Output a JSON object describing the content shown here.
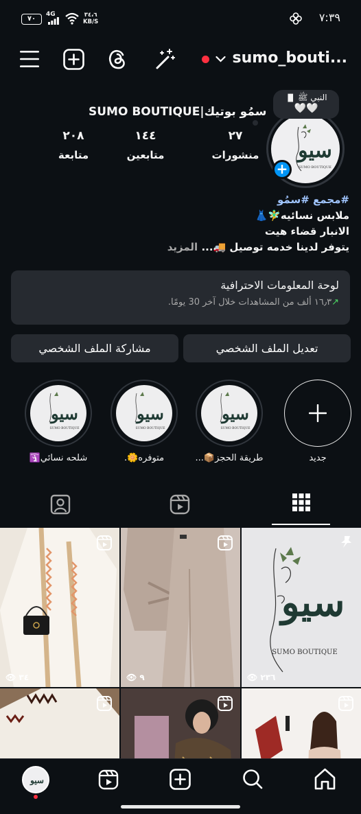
{
  "status": {
    "battery": "٧٠",
    "network": "4G",
    "speed_value": "٣٤،٦",
    "speed_unit": "KB/S",
    "time": "٧:٣٩"
  },
  "topnav": {
    "username": "sumo_bouti..."
  },
  "profile": {
    "note_line1": "النبي ﷺ",
    "note_line2": "🤍🤍",
    "full_name": "SUMO BOUTIQUE|سمُو بوتيك",
    "avatar_brand": "سيو",
    "avatar_sub": "SUMO BOUTIQUE",
    "stats": [
      {
        "value": "٢٧",
        "label": "منشورات"
      },
      {
        "value": "١٤٤",
        "label": "متابعين"
      },
      {
        "value": "٢٠٨",
        "label": "متابعة"
      }
    ]
  },
  "bio": {
    "hashtags": "#مجمع #سمُو",
    "line2": "ملابس نسائيه🧚‍♂️👗",
    "line3": "الانبار قضاء هيت",
    "line4": "يتوفر لدينا خدمه توصيل 🚚...",
    "more": "المزيد"
  },
  "dashboard": {
    "title": "لوحة المعلومات الاحترافية",
    "stat_arrow": "↗",
    "stat_value": "١٦٫٣",
    "stat_text": "ألف من المشاهدات خلال آخر 30 يومًا."
  },
  "buttons": {
    "edit_profile": "تعديل الملف الشخصي",
    "share_profile": "مشاركة الملف الشخصي"
  },
  "highlights": [
    {
      "label": "جديد"
    },
    {
      "label": "طريقة الحجز📦..."
    },
    {
      "label": "متوفره🌼."
    },
    {
      "label": "شلحه نسائي🛐"
    }
  ],
  "grid": {
    "views": [
      "٣٤",
      "٩",
      "٢٣٦"
    ],
    "post_brand": "سيو",
    "post_sub": "SUMO BOUTIQUE"
  },
  "colors": {
    "background": "#0c1014",
    "surface": "#262a30",
    "accent_blue": "#0095f6",
    "live_red": "#ff3040",
    "hashtag": "#a0c5ff"
  }
}
